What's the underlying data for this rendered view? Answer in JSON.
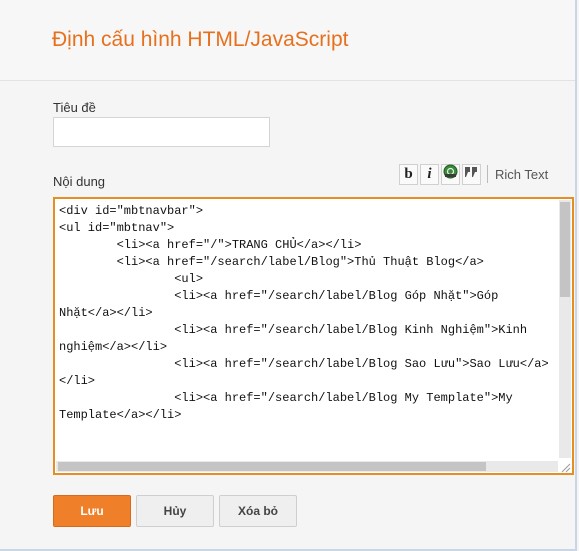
{
  "dialog": {
    "title": "Định cấu hình HTML/JavaScript"
  },
  "form": {
    "title_label": "Tiêu đề",
    "title_value": "",
    "content_label": "Nội dung",
    "rich_text_label": "Rich Text",
    "toolbar": {
      "bold": "b",
      "italic": "i",
      "link_icon": "link-icon",
      "quote": "66"
    },
    "content_value": "<div id=\"mbtnavbar\">\n<ul id=\"mbtnav\">\n        <li><a href=\"/\">TRANG CHỦ</a></li>\n        <li><a href=\"/search/label/Blog\">Thủ Thuật Blog</a>\n                <ul>\n                <li><a href=\"/search/label/Blog Góp Nhặt\">Góp Nhặt</a></li>\n                <li><a href=\"/search/label/Blog Kinh Nghiệm\">Kinh nghiệm</a></li>\n                <li><a href=\"/search/label/Blog Sao Lưu\">Sao Lưu</a></li>\n                <li><a href=\"/search/label/Blog My Template\">My Template</a></li>"
  },
  "buttons": {
    "save": "Lưu",
    "cancel": "Hủy",
    "delete": "Xóa bỏ"
  },
  "colors": {
    "accent": "#e7701d",
    "save_button": "#f07f2a",
    "editor_border": "#e58f23"
  }
}
